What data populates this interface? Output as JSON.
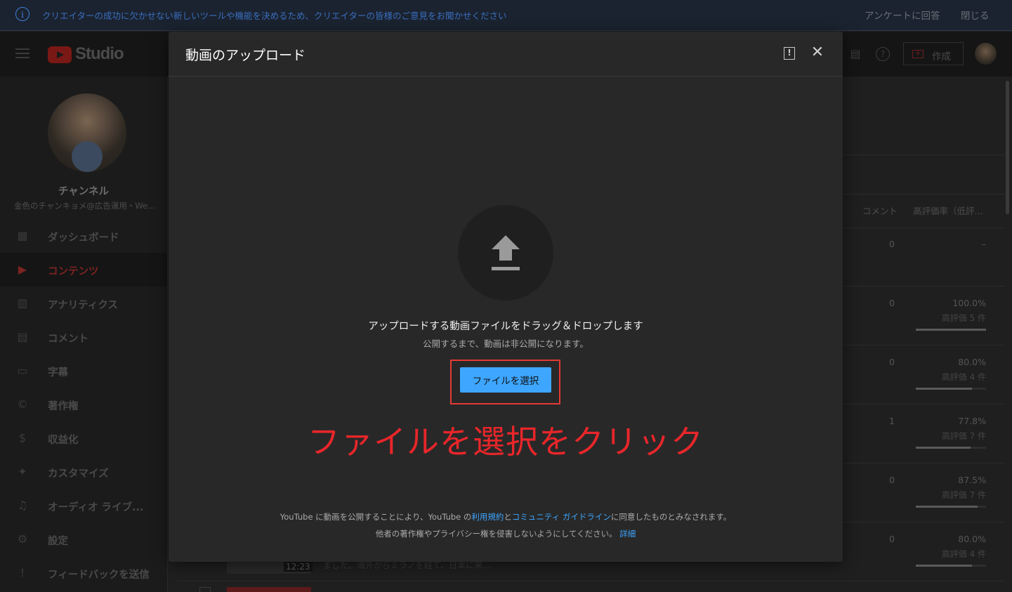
{
  "banner": {
    "info_icon": "info-icon",
    "message": "クリエイターの成功に欠かせない新しいツールや機能を決めるため、クリエイターの皆様のご意見をお聞かせください",
    "survey_label": "アンケートに回答",
    "close_label": "閉じる"
  },
  "topbar": {
    "logo_text": "Studio",
    "create_label": "作成"
  },
  "sidebar": {
    "channel_title": "チャンネル",
    "channel_name": "金色のチャンキョメ@広告運用・We...",
    "items": [
      {
        "label": "ダッシュボード",
        "icon": "dashboard-icon",
        "glyph": "▦"
      },
      {
        "label": "コンテンツ",
        "icon": "content-icon",
        "glyph": "▶"
      },
      {
        "label": "アナリティクス",
        "icon": "analytics-icon",
        "glyph": "▥"
      },
      {
        "label": "コメント",
        "icon": "comment-icon",
        "glyph": "▤"
      },
      {
        "label": "字幕",
        "icon": "subtitles-icon",
        "glyph": "▭"
      },
      {
        "label": "著作権",
        "icon": "copyright-icon",
        "glyph": "©"
      },
      {
        "label": "収益化",
        "icon": "dollar-icon",
        "glyph": "$"
      },
      {
        "label": "カスタマイズ",
        "icon": "magic-wand-icon",
        "glyph": "✦"
      },
      {
        "label": "オーディオ ライブ...",
        "icon": "audio-library-icon",
        "glyph": "♫"
      },
      {
        "label": "設定",
        "icon": "gear-icon",
        "glyph": "⚙"
      },
      {
        "label": "フィードバックを送信",
        "icon": "feedback-icon",
        "glyph": "!"
      }
    ]
  },
  "table": {
    "col_comments": "コメント",
    "col_rating": "高評価率（低評...",
    "rows": [
      {
        "comments": "0",
        "rating": "–",
        "likes": "",
        "fill": 0
      },
      {
        "comments": "0",
        "rating": "100.0%",
        "likes": "高評価 5 件",
        "fill": 1.0
      },
      {
        "comments": "0",
        "rating": "80.0%",
        "likes": "高評価 4 件",
        "fill": 0.8
      },
      {
        "comments": "1",
        "rating": "77.8%",
        "likes": "高評価 7 件",
        "fill": 0.778
      },
      {
        "comments": "0",
        "rating": "87.5%",
        "likes": "高評価 7 件",
        "fill": 0.875
      },
      {
        "comments": "0",
        "rating": "80.0%",
        "likes": "高評価 4 件",
        "fill": 0.8
      }
    ],
    "bg_duration": "12:23",
    "bg_desc": "ました。海外からミラノを経て、日本に来..."
  },
  "modal": {
    "title": "動画のアップロード",
    "drag_text": "アップロードする動画ファイルをドラッグ＆ドロップします",
    "sub_text": "公開するまで、動画は非公開になります。",
    "select_label": "ファイルを選択",
    "annotation": "ファイルを選択をクリック",
    "tos_prefix": "YouTube に動画を公開することにより、YouTube の",
    "tos_link1": "利用規約",
    "tos_and": "と",
    "tos_link2": "コミュニティ ガイドライン",
    "tos_suffix": "に同意したものとみなされます。",
    "tos2_text": "他者の著作権やプライバシー権を侵害しないようにしてください。",
    "tos2_link": "詳細"
  }
}
